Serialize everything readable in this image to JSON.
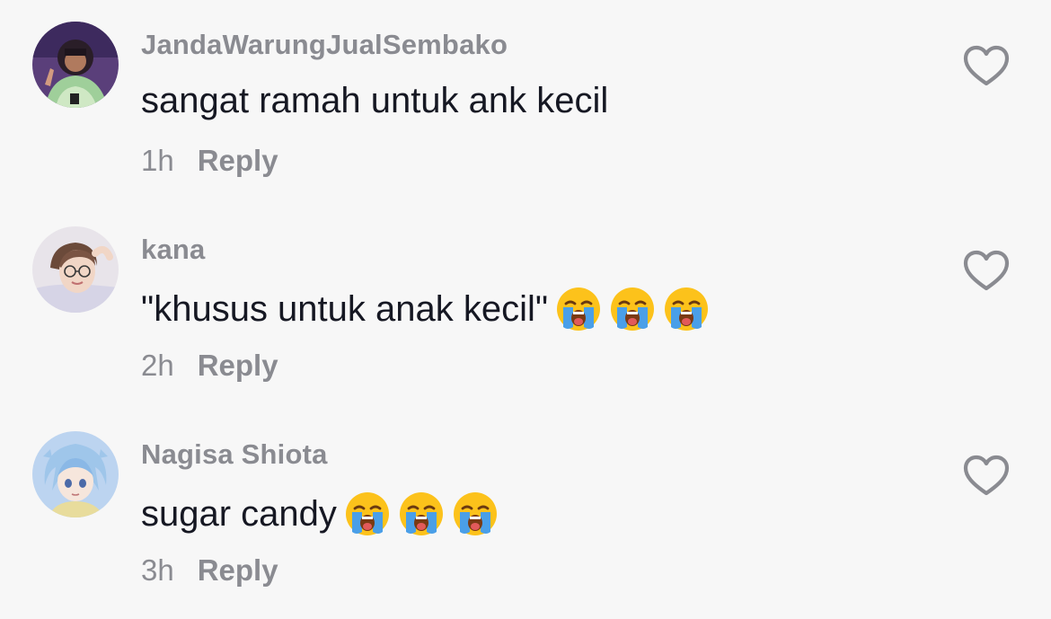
{
  "comments": [
    {
      "username": "JandaWarungJualSembako",
      "text": "sangat ramah untuk ank kecil",
      "time": "1h",
      "reply_label": "Reply",
      "emoji_count": 0,
      "avatar": "avatar-girl-peace-sign"
    },
    {
      "username": "kana",
      "text": "\"khusus untuk anak kecil\"",
      "time": "2h",
      "reply_label": "Reply",
      "emoji_count": 3,
      "emoji": "loudly-crying-face",
      "avatar": "avatar-person-glasses"
    },
    {
      "username": "Nagisa Shiota",
      "text": "sugar candy",
      "time": "3h",
      "reply_label": "Reply",
      "emoji_count": 3,
      "emoji": "loudly-crying-face",
      "avatar": "avatar-anime-character"
    }
  ],
  "icons": {
    "like": "heart-outline-icon"
  },
  "colors": {
    "background": "#f7f7f7",
    "text": "#161823",
    "secondary": "#8a8b91",
    "heart_stroke": "#8a8b91"
  }
}
